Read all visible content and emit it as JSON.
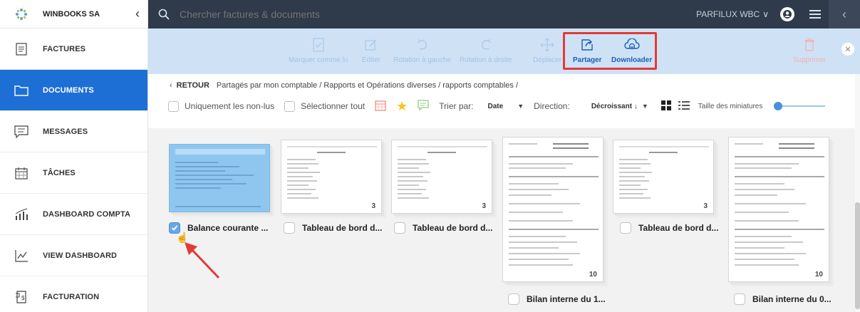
{
  "app": {
    "company": "WINBOOKS SA",
    "account": "PARFILUX WBC",
    "search_placeholder": "Chercher factures & documents"
  },
  "sidebar": {
    "items": [
      {
        "label": "FACTURES",
        "icon": "invoice-icon"
      },
      {
        "label": "DOCUMENTS",
        "icon": "folder-icon",
        "active": true
      },
      {
        "label": "MESSAGES",
        "icon": "message-icon"
      },
      {
        "label": "TÂCHES",
        "icon": "calendar-icon"
      },
      {
        "label": "DASHBOARD COMPTA",
        "icon": "chart-icon"
      },
      {
        "label": "VIEW DASHBOARD",
        "icon": "line-chart-icon"
      },
      {
        "label": "FACTURATION",
        "icon": "billing-icon"
      }
    ]
  },
  "toolbar": {
    "mark_read": "Marquer comme lu",
    "edit": "Editer",
    "rotate_left": "Rotation à gauche",
    "rotate_right": "Rotation à droite",
    "move": "Déplacer",
    "share": "Partager",
    "download": "Downloader",
    "delete": "Supprimer"
  },
  "breadcrumb": {
    "back": "RETOUR",
    "path": "Partagés par mon comptable / Rapports et Opérations diverses / rapports comptables /"
  },
  "filters": {
    "unread_only": "Uniquement les non-lus",
    "select_all": "Sélectionner tout",
    "sort_by_label": "Trier par:",
    "sort_by_value": "Date",
    "direction_label": "Direction:",
    "direction_value": "Décroissant ↓",
    "thumb_size_label": "Taille des miniatures"
  },
  "documents": [
    {
      "title": "Balance courante ...",
      "selected": true,
      "pages": ""
    },
    {
      "title": "Tableau de bord d...",
      "selected": false,
      "pages": "3"
    },
    {
      "title": "Tableau de bord d...",
      "selected": false,
      "pages": "3"
    },
    {
      "title": "Bilan interne du 1...",
      "selected": false,
      "pages": "10"
    },
    {
      "title": "Tableau de bord d...",
      "selected": false,
      "pages": "3"
    },
    {
      "title": "Bilan interne du 0...",
      "selected": false,
      "pages": "10"
    }
  ],
  "colors": {
    "accent": "#1d6fd6",
    "topbar": "#2f3a4a",
    "toolbar": "#cfe2f5",
    "highlight": "#e53935"
  }
}
